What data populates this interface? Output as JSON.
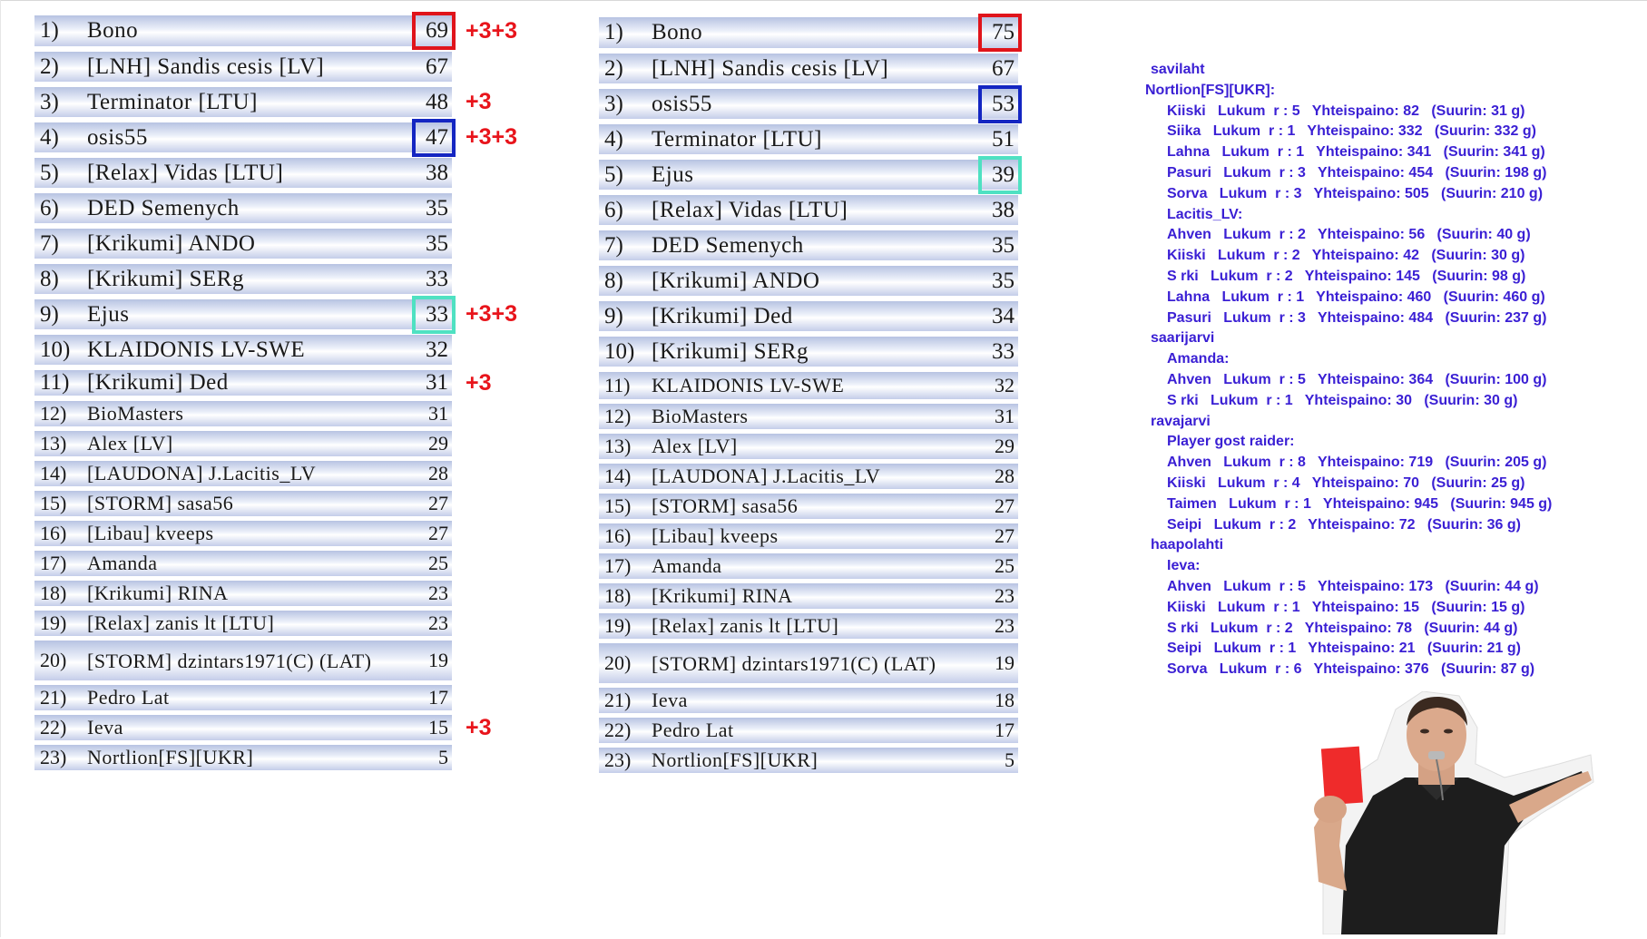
{
  "left_table": {
    "rows": [
      {
        "rank": "1)",
        "name": "Bono",
        "score": "69",
        "bonus": "+3+3",
        "highlight": "red"
      },
      {
        "rank": "2)",
        "name": "[LNH] Sandis cesis [LV]",
        "score": "67"
      },
      {
        "rank": "3)",
        "name": "Terminator [LTU]",
        "score": "48",
        "bonus": "+3"
      },
      {
        "rank": "4)",
        "name": "osis55",
        "score": "47",
        "bonus": "+3+3",
        "highlight": "blue"
      },
      {
        "rank": "5)",
        "name": "[Relax] Vidas [LTU]",
        "score": "38"
      },
      {
        "rank": "6)",
        "name": "DED Semenych",
        "score": "35"
      },
      {
        "rank": "7)",
        "name": "[Krikumi] ANDO",
        "score": "35"
      },
      {
        "rank": "8)",
        "name": "[Krikumi] SERg",
        "score": "33"
      },
      {
        "rank": "9)",
        "name": "Ejus",
        "score": "33",
        "bonus": "+3+3",
        "highlight": "teal"
      },
      {
        "rank": "10)",
        "name": "KLAIDONIS LV-SWE",
        "score": "32"
      },
      {
        "rank": "11)",
        "name": "[Krikumi] Ded",
        "score": "31",
        "bonus": "+3"
      },
      {
        "rank": "12)",
        "name": "BioMasters",
        "score": "31"
      },
      {
        "rank": "13)",
        "name": "Alex [LV]",
        "score": "29"
      },
      {
        "rank": "14)",
        "name": "[LAUDONA] J.Lacitis_LV",
        "score": "28"
      },
      {
        "rank": "15)",
        "name": "[STORM] sasa56",
        "score": "27"
      },
      {
        "rank": "16)",
        "name": "[Libau] kveeps",
        "score": "27"
      },
      {
        "rank": "17)",
        "name": "Amanda",
        "score": "25"
      },
      {
        "rank": "18)",
        "name": "[Krikumi] RINA",
        "score": "23"
      },
      {
        "rank": "19)",
        "name": "[Relax] zanis lt [LTU]",
        "score": "23"
      },
      {
        "rank": "20)",
        "name": "[STORM] dzintars1971(C) (LAT)",
        "score": "19"
      },
      {
        "rank": "21)",
        "name": "Pedro Lat",
        "score": "17"
      },
      {
        "rank": "22)",
        "name": "Ieva",
        "score": "15",
        "bonus": "+3"
      },
      {
        "rank": "23)",
        "name": "Nortlion[FS][UKR]",
        "score": "5"
      }
    ]
  },
  "right_table": {
    "rows": [
      {
        "rank": "1)",
        "name": "Bono",
        "score": "75",
        "highlight": "red"
      },
      {
        "rank": "2)",
        "name": "[LNH] Sandis cesis [LV]",
        "score": "67"
      },
      {
        "rank": "3)",
        "name": "osis55",
        "score": "53",
        "highlight": "blue"
      },
      {
        "rank": "4)",
        "name": "Terminator [LTU]",
        "score": "51"
      },
      {
        "rank": "5)",
        "name": "Ejus",
        "score": "39",
        "highlight": "teal"
      },
      {
        "rank": "6)",
        "name": "[Relax] Vidas [LTU]",
        "score": "38"
      },
      {
        "rank": "7)",
        "name": "DED Semenych",
        "score": "35"
      },
      {
        "rank": "8)",
        "name": "[Krikumi] ANDO",
        "score": "35"
      },
      {
        "rank": "9)",
        "name": "[Krikumi] Ded",
        "score": "34"
      },
      {
        "rank": "10)",
        "name": "[Krikumi] SERg",
        "score": "33"
      },
      {
        "rank": "11)",
        "name": "KLAIDONIS LV-SWE",
        "score": "32"
      },
      {
        "rank": "12)",
        "name": "BioMasters",
        "score": "31"
      },
      {
        "rank": "13)",
        "name": "Alex [LV]",
        "score": "29"
      },
      {
        "rank": "14)",
        "name": "[LAUDONA] J.Lacitis_LV",
        "score": "28"
      },
      {
        "rank": "15)",
        "name": "[STORM] sasa56",
        "score": "27"
      },
      {
        "rank": "16)",
        "name": "[Libau] kveeps",
        "score": "27"
      },
      {
        "rank": "17)",
        "name": "Amanda",
        "score": "25"
      },
      {
        "rank": "18)",
        "name": "[Krikumi] RINA",
        "score": "23"
      },
      {
        "rank": "19)",
        "name": "[Relax] zanis lt [LTU]",
        "score": "23"
      },
      {
        "rank": "20)",
        "name": "[STORM] dzintars1971(C) (LAT)",
        "score": "19"
      },
      {
        "rank": "21)",
        "name": "Ieva",
        "score": "18"
      },
      {
        "rank": "22)",
        "name": "Pedro Lat",
        "score": "17"
      },
      {
        "rank": "23)",
        "name": "Nortlion[FS][UKR]",
        "score": "5"
      }
    ]
  },
  "catch_log": [
    {
      "indent": 0,
      "text": "savilaht"
    },
    {
      "indent": 1,
      "text": "Nortlion[FS][UKR]:"
    },
    {
      "indent": 2,
      "text": "Kiiski   Lukum  r : 5   Yhteispaino: 82   (Suurin: 31 g)"
    },
    {
      "indent": 2,
      "text": "Siika   Lukum  r : 1   Yhteispaino: 332   (Suurin: 332 g)"
    },
    {
      "indent": 2,
      "text": "Lahna   Lukum  r : 1   Yhteispaino: 341   (Suurin: 341 g)"
    },
    {
      "indent": 2,
      "text": "Pasuri   Lukum  r : 3   Yhteispaino: 454   (Suurin: 198 g)"
    },
    {
      "indent": 2,
      "text": "Sorva   Lukum  r : 3   Yhteispaino: 505   (Suurin: 210 g)"
    },
    {
      "indent": 2,
      "text": "Lacitis_LV:"
    },
    {
      "indent": 2,
      "text": "Ahven   Lukum  r : 2   Yhteispaino: 56   (Suurin: 40 g)"
    },
    {
      "indent": 2,
      "text": "Kiiski   Lukum  r : 2   Yhteispaino: 42   (Suurin: 30 g)"
    },
    {
      "indent": 2,
      "text": "S rki   Lukum  r : 2   Yhteispaino: 145   (Suurin: 98 g)"
    },
    {
      "indent": 2,
      "text": "Lahna   Lukum  r : 1   Yhteispaino: 460   (Suurin: 460 g)"
    },
    {
      "indent": 2,
      "text": "Pasuri   Lukum  r : 3   Yhteispaino: 484   (Suurin: 237 g)"
    },
    {
      "indent": 0,
      "text": "saarijarvi"
    },
    {
      "indent": 2,
      "text": "Amanda:"
    },
    {
      "indent": 2,
      "text": "Ahven   Lukum  r : 5   Yhteispaino: 364   (Suurin: 100 g)"
    },
    {
      "indent": 2,
      "text": "S rki   Lukum  r : 1   Yhteispaino: 30   (Suurin: 30 g)"
    },
    {
      "indent": 0,
      "text": "ravajarvi"
    },
    {
      "indent": 2,
      "text": "Player gost raider:"
    },
    {
      "indent": 2,
      "text": "Ahven   Lukum  r : 8   Yhteispaino: 719   (Suurin: 205 g)"
    },
    {
      "indent": 2,
      "text": "Kiiski   Lukum  r : 4   Yhteispaino: 70   (Suurin: 25 g)"
    },
    {
      "indent": 2,
      "text": "Taimen   Lukum  r : 1   Yhteispaino: 945   (Suurin: 945 g)"
    },
    {
      "indent": 2,
      "text": "Seipi   Lukum  r : 2   Yhteispaino: 72   (Suurin: 36 g)"
    },
    {
      "indent": 0,
      "text": "haapolahti"
    },
    {
      "indent": 2,
      "text": "Ieva:"
    },
    {
      "indent": 2,
      "text": "Ahven   Lukum  r : 5   Yhteispaino: 173   (Suurin: 44 g)"
    },
    {
      "indent": 2,
      "text": "Kiiski   Lukum  r : 1   Yhteispaino: 15   (Suurin: 15 g)"
    },
    {
      "indent": 2,
      "text": "S rki   Lukum  r : 2   Yhteispaino: 78   (Suurin: 44 g)"
    },
    {
      "indent": 2,
      "text": "Seipi   Lukum  r : 1   Yhteispaino: 21   (Suurin: 21 g)"
    },
    {
      "indent": 2,
      "text": "Sorva   Lukum  r : 6   Yhteispaino: 376   (Suurin: 87 g)"
    }
  ],
  "referee_image": {
    "icon": "referee-red-card-icon"
  }
}
